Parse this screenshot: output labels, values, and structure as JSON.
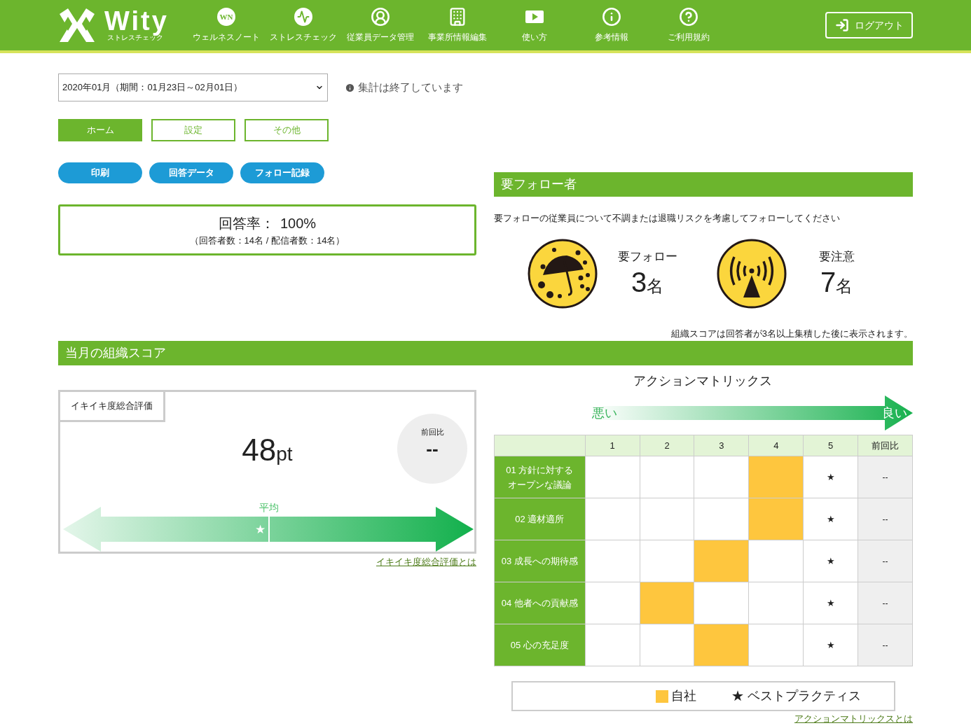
{
  "header": {
    "logo": {
      "name": "Wity",
      "sub": "ストレスチェック"
    },
    "nav": [
      {
        "kind": "wn",
        "label": "ウェルネスノート",
        "icon_text": "WN"
      },
      {
        "kind": "pulse",
        "label": "ストレスチェック"
      },
      {
        "kind": "user",
        "label": "従業員データ管理"
      },
      {
        "kind": "building",
        "label": "事業所情報編集"
      },
      {
        "kind": "video",
        "label": "使い方"
      },
      {
        "kind": "info",
        "label": "参考情報"
      },
      {
        "kind": "help",
        "label": "ご利用規約"
      }
    ],
    "logout": "ログアウト"
  },
  "period": {
    "value": "2020年01月（期間：01月23日～02月01日）",
    "status": "集計は終了しています"
  },
  "tabs": [
    {
      "label": "ホーム",
      "selected": true
    },
    {
      "label": "設定",
      "selected": false
    },
    {
      "label": "その他",
      "selected": false
    }
  ],
  "actions": [
    "印刷",
    "回答データ",
    "フォロー記録"
  ],
  "response": {
    "label": "回答率：",
    "value": "100%",
    "detail": "（回答者数：14名 / 配信者数：14名）"
  },
  "follow": {
    "title": "要フォロー者",
    "description": "要フォローの従業員について不調または退職リスクを考慮してフォローしてください",
    "groups": [
      {
        "kind": "umbrella",
        "label": "要フォロー",
        "count": "3",
        "unit": "名"
      },
      {
        "kind": "antenna",
        "label": "要注意",
        "count": "7",
        "unit": "名"
      }
    ]
  },
  "note": "組織スコアは回答者が3名以上集積した後に表示されます。",
  "score_section": {
    "title": "当月の組織スコア"
  },
  "score": {
    "tab": "イキイキ度総合評価",
    "value": "48",
    "unit": "pt",
    "diff_label": "前回比",
    "diff": "--",
    "average": "平均",
    "marker": "★",
    "level": 0.48,
    "link": "イキイキ度総合評価とは"
  },
  "matrix": {
    "title": "アクションマトリックス",
    "bad": "悪い",
    "good": "良い",
    "columns": [
      "1",
      "2",
      "3",
      "4",
      "5",
      "前回比"
    ],
    "rows": [
      {
        "label": [
          "01 方針に対する",
          "オープンな議論"
        ],
        "cells": [
          {
            "own": false
          },
          {
            "own": false
          },
          {
            "own": false
          },
          {
            "own": true
          },
          {
            "own": false,
            "text": "★"
          }
        ],
        "diff": "--"
      },
      {
        "label": [
          "02 適材適所"
        ],
        "cells": [
          {
            "own": false
          },
          {
            "own": false
          },
          {
            "own": false
          },
          {
            "own": true
          },
          {
            "own": false,
            "text": "★"
          }
        ],
        "diff": "--"
      },
      {
        "label": [
          "03 成長への期待感"
        ],
        "cells": [
          {
            "own": false
          },
          {
            "own": false
          },
          {
            "own": true
          },
          {
            "own": false
          },
          {
            "own": false,
            "text": "★"
          }
        ],
        "diff": "--"
      },
      {
        "label": [
          "04 他者への貢献感"
        ],
        "cells": [
          {
            "own": false
          },
          {
            "own": true
          },
          {
            "own": false
          },
          {
            "own": false
          },
          {
            "own": false,
            "text": "★"
          }
        ],
        "diff": "--"
      },
      {
        "label": [
          "05 心の充足度"
        ],
        "cells": [
          {
            "own": false
          },
          {
            "own": false
          },
          {
            "own": true
          },
          {
            "own": false
          },
          {
            "own": false,
            "text": "★"
          }
        ],
        "diff": "--"
      }
    ],
    "legend": {
      "own": "自社",
      "best": "★ ベストプラクティス"
    },
    "link": "アクションマトリックスとは"
  }
}
